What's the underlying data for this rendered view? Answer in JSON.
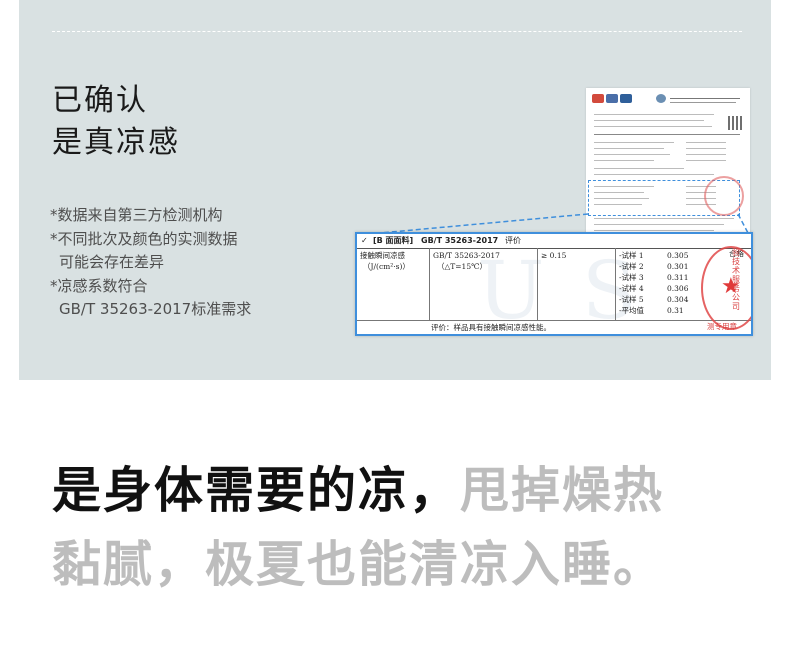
{
  "headline": {
    "line1": "已确认",
    "line2": "是真凉感"
  },
  "notes": [
    "*数据来自第三方检测机构",
    "*不同批次及颜色的实测数据",
    "可能会存在差异",
    "*凉感系数符合",
    "GB/T 35263-2017标准需求"
  ],
  "report": {
    "header": {
      "check": "✓",
      "item": "[B 面面料]",
      "standard": "GB/T 35263-2017",
      "verdict": "评价"
    },
    "property": "接触瞬间凉感",
    "unit": "（J/(cm²·s)）",
    "standard": "GB/T 35263-2017",
    "condition": "（△T=15℃）",
    "requirement": "≥ 0.15",
    "rows": [
      {
        "label": "-试样 1",
        "value": "0.305"
      },
      {
        "label": "-试样 2",
        "value": "0.301"
      },
      {
        "label": "-试样 3",
        "value": "0.311"
      },
      {
        "label": "-试样 4",
        "value": "0.306"
      },
      {
        "label": "-试样 5",
        "value": "0.304"
      },
      {
        "label": "-平均值",
        "value": "0.31"
      }
    ],
    "result": "合格",
    "footer": "评价：样品具有接触瞬间凉感性能。",
    "stamp_text": "验技术服务公司",
    "stamp_bottom": "测专用章"
  },
  "slogan": {
    "line1_dark": "是身体需要的凉，",
    "line1_light": "甩掉燥热",
    "line2_light": "黏腻，极夏也能清凉入睡。"
  },
  "colors": {
    "panel": "#d9e1e2",
    "highlight_border": "#3f8fdc",
    "stamp": "#e04848"
  }
}
